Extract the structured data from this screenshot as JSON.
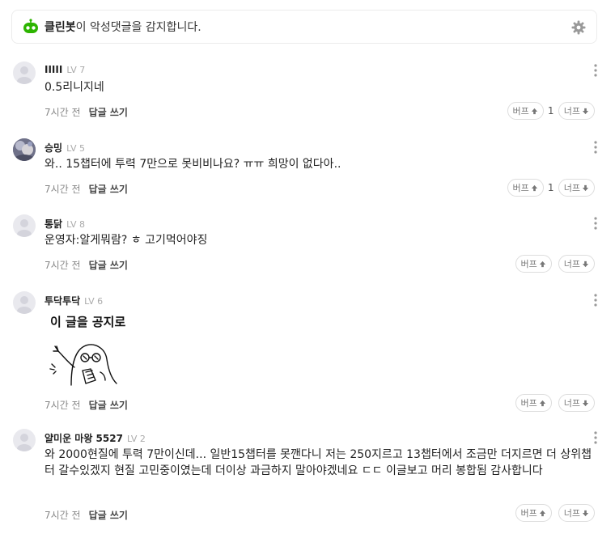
{
  "cleanbot": {
    "name": "클린봇",
    "message": "이 악성댓글을 감지합니다."
  },
  "comments": [
    {
      "author": "IIIII",
      "level": "LV 7",
      "text": "0.5리니지네",
      "time": "7시간 전",
      "reply": "답글 쓰기",
      "up_label": "버프",
      "up_count": "1",
      "down_label": "너프"
    },
    {
      "author": "승밍",
      "level": "LV 5",
      "text": "와.. 15챕터에 투력 7만으로 못비비나요? ㅠㅠ 희망이 없다아..",
      "time": "7시간 전",
      "reply": "답글 쓰기",
      "up_label": "버프",
      "up_count": "1",
      "down_label": "너프"
    },
    {
      "author": "통닭",
      "level": "LV 8",
      "text": "운영자:알게뭐람? ㅎ 고기먹어야징",
      "time": "7시간 전",
      "reply": "답글 쓰기",
      "up_label": "버프",
      "up_count": "",
      "down_label": "너프"
    },
    {
      "author": "투닥투닥",
      "level": "LV 6",
      "sticker_caption": "이 글을 공지로",
      "time": "7시간 전",
      "reply": "답글 쓰기",
      "up_label": "버프",
      "up_count": "",
      "down_label": "너프"
    },
    {
      "author": "얄미운 마왕 5527",
      "level": "LV 2",
      "text": "와 2000현질에 투력 7만이신데... 일반15챕터를 못깬다니 저는 250지르고 13챕터에서 조금만 더지르면 더 상위챕터 갈수있겠지 현질 고민중이였는데 더이상 과금하지 말아야겠네요 ㄷㄷ 이글보고 머리 봉합됨 감사합니다",
      "time": "7시간 전",
      "reply": "답글 쓰기",
      "up_label": "버프",
      "up_count": "",
      "down_label": "너프"
    }
  ],
  "colors": {
    "cleanbot_green": "#2db400",
    "border": "#dddddd",
    "muted": "#888888"
  }
}
